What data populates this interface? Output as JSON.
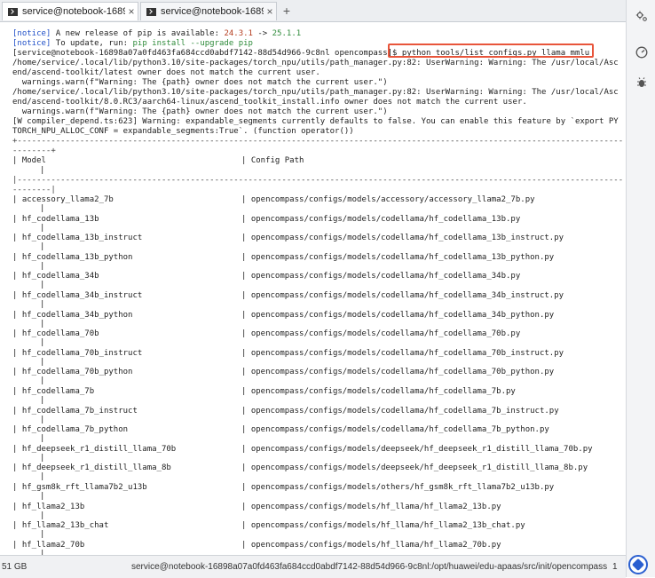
{
  "tabs": [
    {
      "label": "service@notebook-16898a",
      "close": "×",
      "active": true
    },
    {
      "label": "service@notebook-16898a",
      "close": "×",
      "active": false
    }
  ],
  "tab_add": "+",
  "sidebar_icons": [
    "settings-gear-icon",
    "gauge-icon",
    "bug-icon"
  ],
  "notice": {
    "line1_prefix": "[notice]",
    "line1_text": " A new release of pip is available: ",
    "line1_old": "24.3.1",
    "line1_arrow": " -> ",
    "line1_new": "25.1.1",
    "line2_prefix": "[notice]",
    "line2_text": " To update, run: ",
    "line2_cmd": "pip install --upgrade pip"
  },
  "prompt": "[service@notebook-16898a07a0fd463fa684ccd0abdf7142-88d54d966-9c8nl opencompass]$ ",
  "command": "python tools/list_configs.py llama mmlu",
  "warnings": [
    "/home/service/.local/lib/python3.10/site-packages/torch_npu/utils/path_manager.py:82: UserWarning: Warning: The /usr/local/Asc",
    "end/ascend-toolkit/latest owner does not match the current user.",
    "  warnings.warn(f\"Warning: The {path} owner does not match the current user.\")",
    "/home/service/.local/lib/python3.10/site-packages/torch_npu/utils/path_manager.py:82: UserWarning: Warning: The /usr/local/Asc",
    "end/ascend-toolkit/8.0.RC3/aarch64-linux/ascend_toolkit_install.info owner does not match the current user.",
    "  warnings.warn(f\"Warning: The {path} owner does not match the current user.\")",
    "[W compiler_depend.ts:623] Warning: expandable_segments currently defaults to false. You can enable this feature by `export PY",
    "TORCH_NPU_ALLOC_CONF = expandable_segments:True`. (function operator())"
  ],
  "table_rule_top": "+------------------------------------------------------------------------------------------------------------------------------",
  "table_rule_wrap": "--------+",
  "table_header": {
    "col1": "| Model",
    "col2": "| Config Path"
  },
  "table_rule_mid": "|------------------------------------------------------------------------------------------------------------------------------",
  "table_rule_mid_wrap": "--------|",
  "rows": [
    {
      "model": "| accessory_llama2_7b",
      "path": "| opencompass/configs/models/accessory/accessory_llama2_7b.py"
    },
    {
      "model": "| hf_codellama_13b",
      "path": "| opencompass/configs/models/codellama/hf_codellama_13b.py"
    },
    {
      "model": "| hf_codellama_13b_instruct",
      "path": "| opencompass/configs/models/codellama/hf_codellama_13b_instruct.py"
    },
    {
      "model": "| hf_codellama_13b_python",
      "path": "| opencompass/configs/models/codellama/hf_codellama_13b_python.py"
    },
    {
      "model": "| hf_codellama_34b",
      "path": "| opencompass/configs/models/codellama/hf_codellama_34b.py"
    },
    {
      "model": "| hf_codellama_34b_instruct",
      "path": "| opencompass/configs/models/codellama/hf_codellama_34b_instruct.py"
    },
    {
      "model": "| hf_codellama_34b_python",
      "path": "| opencompass/configs/models/codellama/hf_codellama_34b_python.py"
    },
    {
      "model": "| hf_codellama_70b",
      "path": "| opencompass/configs/models/codellama/hf_codellama_70b.py"
    },
    {
      "model": "| hf_codellama_70b_instruct",
      "path": "| opencompass/configs/models/codellama/hf_codellama_70b_instruct.py"
    },
    {
      "model": "| hf_codellama_70b_python",
      "path": "| opencompass/configs/models/codellama/hf_codellama_70b_python.py"
    },
    {
      "model": "| hf_codellama_7b",
      "path": "| opencompass/configs/models/codellama/hf_codellama_7b.py"
    },
    {
      "model": "| hf_codellama_7b_instruct",
      "path": "| opencompass/configs/models/codellama/hf_codellama_7b_instruct.py"
    },
    {
      "model": "| hf_codellama_7b_python",
      "path": "| opencompass/configs/models/codellama/hf_codellama_7b_python.py"
    },
    {
      "model": "| hf_deepseek_r1_distill_llama_70b",
      "path": "| opencompass/configs/models/deepseek/hf_deepseek_r1_distill_llama_70b.py"
    },
    {
      "model": "| hf_deepseek_r1_distill_llama_8b",
      "path": "| opencompass/configs/models/deepseek/hf_deepseek_r1_distill_llama_8b.py"
    },
    {
      "model": "| hf_gsm8k_rft_llama7b2_u13b",
      "path": "| opencompass/configs/models/others/hf_gsm8k_rft_llama7b2_u13b.py"
    },
    {
      "model": "| hf_llama2_13b",
      "path": "| opencompass/configs/models/hf_llama/hf_llama2_13b.py"
    },
    {
      "model": "| hf_llama2_13b_chat",
      "path": "| opencompass/configs/models/hf_llama/hf_llama2_13b_chat.py"
    },
    {
      "model": "| hf_llama2_70b",
      "path": "| opencompass/configs/models/hf_llama/hf_llama2_70b.py"
    }
  ],
  "row_wrap_char": "|",
  "status": {
    "left": "51 GB",
    "path": "service@notebook-16898a07a0fd463fa684ccd0abdf7142-88d54d966-9c8nl:/opt/huawei/edu-apaas/src/init/opencompass",
    "num": "1"
  },
  "colors": {
    "highlight_box": "#e8553b",
    "notice": "#2150c8",
    "old_version": "#b43c1e",
    "new_version": "#2e8b3a"
  }
}
